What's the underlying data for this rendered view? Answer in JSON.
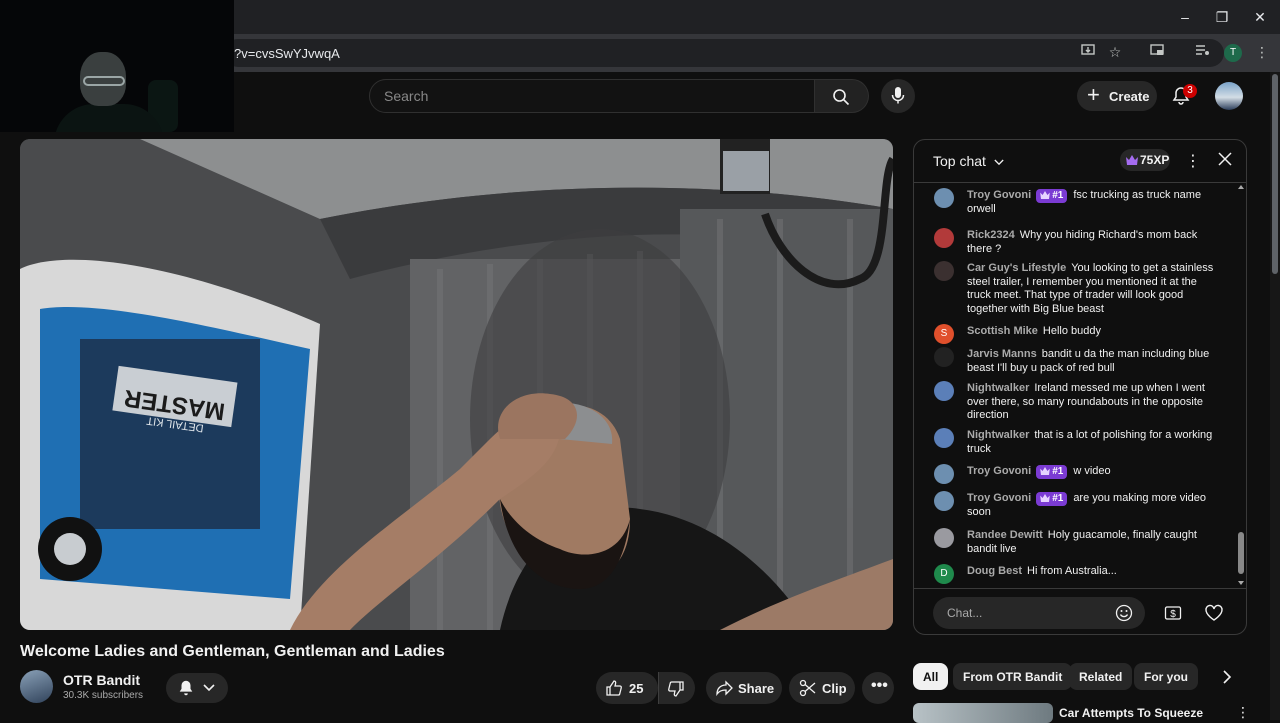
{
  "browser": {
    "url": "?v=cvsSwYJvwqA",
    "profile_initial": "T",
    "window_controls": [
      "minimize-icon",
      "maximize-icon",
      "close-icon"
    ]
  },
  "header": {
    "search_placeholder": "Search",
    "create_label": "Create",
    "notification_count": "3"
  },
  "video": {
    "title": "Welcome Ladies and Gentleman, Gentleman and Ladies",
    "bucket_brand": "MASTER",
    "bucket_sub": "DETAIL KIT"
  },
  "channel": {
    "name": "OTR Bandit",
    "subscribers": "30.3K subscribers"
  },
  "actions": {
    "like_count": "25",
    "share_label": "Share",
    "clip_label": "Clip"
  },
  "chat": {
    "mode_label": "Top chat",
    "xp_label": "75XP",
    "input_placeholder": "Chat...",
    "messages": [
      {
        "author": "Troy Govoni",
        "rank": "#1",
        "text": "fsc trucking as truck name orwell",
        "avatar_color": "#6d8fb0",
        "initial": ""
      },
      {
        "author": "Rick2324",
        "rank": "",
        "text": "Why you hiding Richard's mom back there ?",
        "avatar_color": "#b23a3a",
        "initial": ""
      },
      {
        "author": "Car Guy's Lifestyle",
        "rank": "",
        "text": "You looking to get a stainless steel trailer, I remember you mentioned it at the truck meet. That type of trader will look good together with Big Blue beast",
        "avatar_color": "#3b3030",
        "initial": ""
      },
      {
        "author": "Scottish Mike",
        "rank": "",
        "text": "Hello buddy",
        "avatar_color": "#e0502c",
        "initial": "S"
      },
      {
        "author": "Jarvis Manns",
        "rank": "",
        "text": "bandit u da the man including blue beast I'll buy u pack of red bull",
        "avatar_color": "#222222",
        "initial": ""
      },
      {
        "author": "Nightwalker",
        "rank": "",
        "text": "Ireland messed me up when I went over there, so many roundabouts in the opposite direction",
        "avatar_color": "#5b7fb8",
        "initial": ""
      },
      {
        "author": "Nightwalker",
        "rank": "",
        "text": "that is a lot of polishing for a working truck",
        "avatar_color": "#5b7fb8",
        "initial": ""
      },
      {
        "author": "Troy Govoni",
        "rank": "#1",
        "text": "w video",
        "avatar_color": "#6d8fb0",
        "initial": ""
      },
      {
        "author": "Troy Govoni",
        "rank": "#1",
        "text": "are you making more video soon",
        "avatar_color": "#6d8fb0",
        "initial": ""
      },
      {
        "author": "Randee Dewitt",
        "rank": "",
        "text": "Holy guacamole, finally caught bandit live",
        "avatar_color": "#9a9aa0",
        "initial": ""
      },
      {
        "author": "Doug Best",
        "rank": "",
        "text": "Hi from Australia...",
        "avatar_color": "#1f8a4c",
        "initial": "D"
      }
    ]
  },
  "recommendations": {
    "chips": [
      "All",
      "From OTR Bandit",
      "Related",
      "For you"
    ],
    "active_chip": "All",
    "first_title": "Car Attempts To Squeeze"
  },
  "colors": {
    "background": "#0f0f0f",
    "surface": "#272727",
    "rank_badge": "#7b3bd3",
    "notification_badge": "#cc0000"
  }
}
